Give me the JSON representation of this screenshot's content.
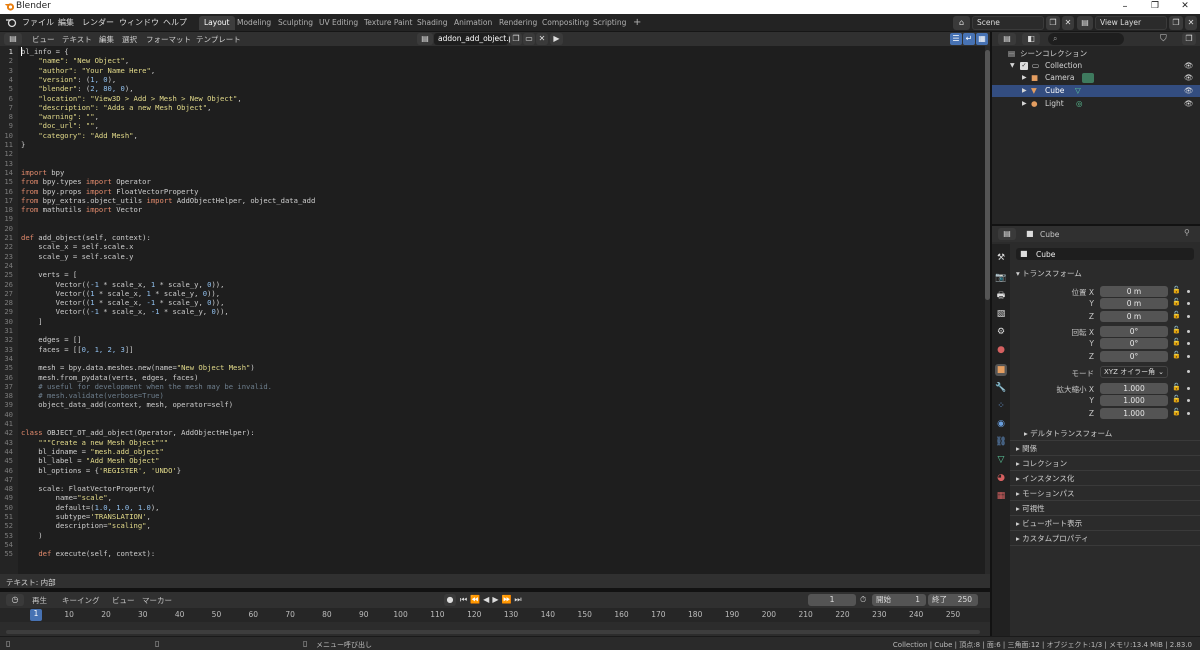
{
  "window": {
    "title": "Blender",
    "min": "–",
    "max": "❐",
    "close": "✕"
  },
  "menubar": {
    "items": [
      "ファイル",
      "編集",
      "レンダー",
      "ウィンドウ",
      "ヘルプ"
    ],
    "workspaces": [
      "Layout",
      "Modeling",
      "Sculpting",
      "UV Editing",
      "Texture Paint",
      "Shading",
      "Animation",
      "Rendering",
      "Compositing",
      "Scripting"
    ],
    "add_tab": "+",
    "scene": "Scene",
    "view_layer": "View Layer"
  },
  "text_editor": {
    "menu": [
      "ビュー",
      "テキスト",
      "編集",
      "選択",
      "フォーマット",
      "テンプレート"
    ],
    "filename": "addon_add_object.py",
    "footer": "テキスト: 内部",
    "lines": [
      [
        [
          "bl_info = {",
          ""
        ]
      ],
      [
        [
          "    ",
          ""
        ],
        [
          "\"name\": \"New Object\"",
          "st"
        ],
        [
          ",",
          ""
        ]
      ],
      [
        [
          "    ",
          ""
        ],
        [
          "\"author\": \"Your Name Here\"",
          "st"
        ],
        [
          ",",
          ""
        ]
      ],
      [
        [
          "    ",
          ""
        ],
        [
          "\"version\"",
          "st"
        ],
        [
          ": (",
          ""
        ],
        [
          "1, 0",
          "nu"
        ],
        [
          "),",
          ""
        ]
      ],
      [
        [
          "    ",
          ""
        ],
        [
          "\"blender\"",
          "st"
        ],
        [
          ": (",
          ""
        ],
        [
          "2, 80, 0",
          "nu"
        ],
        [
          "),",
          ""
        ]
      ],
      [
        [
          "    ",
          ""
        ],
        [
          "\"location\": \"View3D > Add > Mesh > New Object\"",
          "st"
        ],
        [
          ",",
          ""
        ]
      ],
      [
        [
          "    ",
          ""
        ],
        [
          "\"description\": \"Adds a new Mesh Object\"",
          "st"
        ],
        [
          ",",
          ""
        ]
      ],
      [
        [
          "    ",
          ""
        ],
        [
          "\"warning\": \"\"",
          "st"
        ],
        [
          ",",
          ""
        ]
      ],
      [
        [
          "    ",
          ""
        ],
        [
          "\"doc_url\": \"\"",
          "st"
        ],
        [
          ",",
          ""
        ]
      ],
      [
        [
          "    ",
          ""
        ],
        [
          "\"category\": \"Add Mesh\"",
          "st"
        ],
        [
          ",",
          ""
        ]
      ],
      [
        [
          "}",
          ""
        ]
      ],
      [
        [
          "",
          ""
        ]
      ],
      [
        [
          "",
          ""
        ]
      ],
      [
        [
          "import",
          "kw"
        ],
        [
          " bpy",
          ""
        ]
      ],
      [
        [
          "from",
          "kw"
        ],
        [
          " bpy.types ",
          ""
        ],
        [
          "import",
          "kw"
        ],
        [
          " Operator",
          ""
        ]
      ],
      [
        [
          "from",
          "kw"
        ],
        [
          " bpy.props ",
          ""
        ],
        [
          "import",
          "kw"
        ],
        [
          " FloatVectorProperty",
          ""
        ]
      ],
      [
        [
          "from",
          "kw"
        ],
        [
          " bpy_extras.object_utils ",
          ""
        ],
        [
          "import",
          "kw"
        ],
        [
          " AddObjectHelper, object_data_add",
          ""
        ]
      ],
      [
        [
          "from",
          "kw"
        ],
        [
          " mathutils ",
          ""
        ],
        [
          "import",
          "kw"
        ],
        [
          " Vector",
          ""
        ]
      ],
      [
        [
          "",
          ""
        ]
      ],
      [
        [
          "",
          ""
        ]
      ],
      [
        [
          "def",
          "kw"
        ],
        [
          " add_object(self, context):",
          ""
        ]
      ],
      [
        [
          "    scale_x = self.scale.x",
          ""
        ]
      ],
      [
        [
          "    scale_y = self.scale.y",
          ""
        ]
      ],
      [
        [
          "",
          ""
        ]
      ],
      [
        [
          "    verts = [",
          ""
        ]
      ],
      [
        [
          "        Vector((",
          ""
        ],
        [
          "-1",
          "nu"
        ],
        [
          " * scale_x, ",
          ""
        ],
        [
          "1",
          "nu"
        ],
        [
          " * scale_y, ",
          ""
        ],
        [
          "0",
          "nu"
        ],
        [
          ")),",
          ""
        ]
      ],
      [
        [
          "        Vector((",
          ""
        ],
        [
          "1",
          "nu"
        ],
        [
          " * scale_x, ",
          ""
        ],
        [
          "1",
          "nu"
        ],
        [
          " * scale_y, ",
          ""
        ],
        [
          "0",
          "nu"
        ],
        [
          ")),",
          ""
        ]
      ],
      [
        [
          "        Vector((",
          ""
        ],
        [
          "1",
          "nu"
        ],
        [
          " * scale_x, ",
          ""
        ],
        [
          "-1",
          "nu"
        ],
        [
          " * scale_y, ",
          ""
        ],
        [
          "0",
          "nu"
        ],
        [
          ")),",
          ""
        ]
      ],
      [
        [
          "        Vector((",
          ""
        ],
        [
          "-1",
          "nu"
        ],
        [
          " * scale_x, ",
          ""
        ],
        [
          "-1",
          "nu"
        ],
        [
          " * scale_y, ",
          ""
        ],
        [
          "0",
          "nu"
        ],
        [
          ")),",
          ""
        ]
      ],
      [
        [
          "    ]",
          ""
        ]
      ],
      [
        [
          "",
          ""
        ]
      ],
      [
        [
          "    edges = []",
          ""
        ]
      ],
      [
        [
          "    faces = [[",
          ""
        ],
        [
          "0, 1, 2, 3",
          "nu"
        ],
        [
          "]]",
          ""
        ]
      ],
      [
        [
          "",
          ""
        ]
      ],
      [
        [
          "    mesh = bpy.data.meshes.new(name=",
          ""
        ],
        [
          "\"New Object Mesh\"",
          "st"
        ],
        [
          ")",
          ""
        ]
      ],
      [
        [
          "    mesh.from_pydata(verts, edges, faces)",
          ""
        ]
      ],
      [
        [
          "    # useful for development when the mesh may be invalid.",
          "cm"
        ]
      ],
      [
        [
          "    # mesh.validate(verbose=True)",
          "cm"
        ]
      ],
      [
        [
          "    object_data_add(context, mesh, operator=self)",
          ""
        ]
      ],
      [
        [
          "",
          ""
        ]
      ],
      [
        [
          "",
          ""
        ]
      ],
      [
        [
          "class",
          "kw"
        ],
        [
          " OBJECT_OT_add_object(Operator, AddObjectHelper):",
          ""
        ]
      ],
      [
        [
          "    ",
          ""
        ],
        [
          "\"\"\"Create a new Mesh Object\"\"\"",
          "st"
        ]
      ],
      [
        [
          "    bl_idname = ",
          ""
        ],
        [
          "\"mesh.add_object\"",
          "st"
        ]
      ],
      [
        [
          "    bl_label = ",
          ""
        ],
        [
          "\"Add Mesh Object\"",
          "st"
        ]
      ],
      [
        [
          "    bl_options = {",
          ""
        ],
        [
          "'REGISTER', 'UNDO'",
          "st"
        ],
        [
          "}",
          ""
        ]
      ],
      [
        [
          "",
          ""
        ]
      ],
      [
        [
          "    scale: FloatVectorProperty(",
          ""
        ]
      ],
      [
        [
          "        name=",
          ""
        ],
        [
          "\"scale\"",
          "st"
        ],
        [
          ",",
          ""
        ]
      ],
      [
        [
          "        default=(",
          ""
        ],
        [
          "1.0, 1.0, 1.0",
          "nu"
        ],
        [
          "),",
          ""
        ]
      ],
      [
        [
          "        subtype=",
          ""
        ],
        [
          "'TRANSLATION'",
          "st"
        ],
        [
          ",",
          ""
        ]
      ],
      [
        [
          "        description=",
          ""
        ],
        [
          "\"scaling\"",
          "st"
        ],
        [
          ",",
          ""
        ]
      ],
      [
        [
          "    )",
          ""
        ]
      ],
      [
        [
          "",
          ""
        ]
      ],
      [
        [
          "    ",
          ""
        ],
        [
          "def",
          "kw"
        ],
        [
          " execute(self, context):",
          ""
        ]
      ]
    ]
  },
  "timeline": {
    "menu": [
      "再生",
      "キーイング",
      "ビュー",
      "マーカー"
    ],
    "current": "1",
    "start_label": "開始",
    "start": "1",
    "end_label": "終了",
    "end": "250",
    "ticks": [
      "1",
      "10",
      "20",
      "30",
      "40",
      "50",
      "60",
      "70",
      "80",
      "90",
      "100",
      "110",
      "120",
      "130",
      "140",
      "150",
      "160",
      "170",
      "180",
      "190",
      "200",
      "210",
      "220",
      "230",
      "240",
      "250"
    ]
  },
  "statusbar": {
    "hint": "メニュー呼び出し",
    "info": "Collection | Cube | 頂点:8 | 面:6 | 三角面:12 | オブジェクト:1/3 | メモリ:13.4 MiB | 2.83.0"
  },
  "outliner": {
    "root": "シーンコレクション",
    "collection": "Collection",
    "items": [
      "Camera",
      "Cube",
      "Light"
    ]
  },
  "properties": {
    "object": "Cube",
    "object_name": "Cube",
    "transform": "トランスフォーム",
    "loc_label": "位置 X",
    "rot_label": "回転 X",
    "scale_label": "拡大縮小 X",
    "y": "Y",
    "z": "Z",
    "loc": [
      "0 m",
      "0 m",
      "0 m"
    ],
    "rot": [
      "0°",
      "0°",
      "0°"
    ],
    "scale": [
      "1.000",
      "1.000",
      "1.000"
    ],
    "mode_label": "モード",
    "mode": "XYZ オイラー角",
    "delta": "デルタトランスフォーム",
    "panels": [
      "関係",
      "コレクション",
      "インスタンス化",
      "モーションパス",
      "可視性",
      "ビューポート表示",
      "カスタムプロパティ"
    ]
  },
  "colors": {
    "accent": "#4772b3",
    "selected_row": "#334d80"
  }
}
